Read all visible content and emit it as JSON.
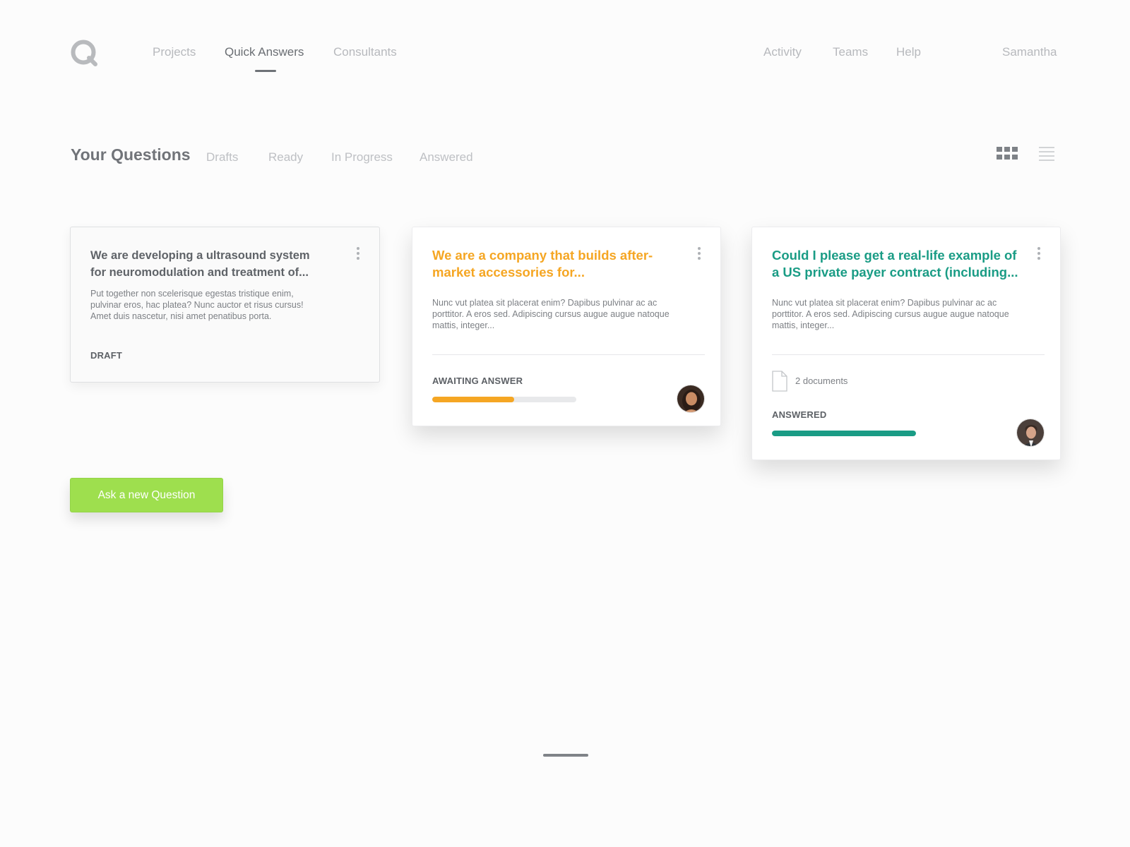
{
  "nav": {
    "logo_icon": "q-logo-icon",
    "left_links": [
      "Projects",
      "Quick Answers",
      "Consultants"
    ],
    "active_link": "Quick Answers",
    "right_links": [
      "Activity",
      "Teams",
      "Help"
    ],
    "user_name": "Samantha"
  },
  "questions": {
    "title": "Your Questions",
    "filters": [
      "Drafts",
      "Ready",
      "In Progress",
      "Answered"
    ],
    "view_icons": [
      "grid-view-icon",
      "list-view-icon"
    ]
  },
  "cards": [
    {
      "title": "We are developing a ultrasound system for neuromodulation and treatment of...",
      "body": "Put together non scelerisque egestas tristique enim, pulvinar eros, hac platea? Nunc auctor et risus cursus! Amet duis nascetur, nisi amet penatibus porta.",
      "status": "DRAFT"
    },
    {
      "title": "We are a company that builds after-market accessories for...",
      "body": "Nunc vut platea sit placerat enim? Dapibus pulvinar ac ac porttitor. A eros sed. Adipiscing cursus augue augue natoque mattis, integer...",
      "status": "AWAITING ANSWER",
      "progress": 0.57,
      "color": "#f5a623"
    },
    {
      "title": "Could I please get a real-life example of a US private payer contract (including...",
      "body": "Nunc vut platea sit placerat enim? Dapibus pulvinar ac ac porttitor. A eros sed. Adipiscing cursus augue augue natoque mattis, integer...",
      "documents": "2 documents",
      "status": "ANSWERED",
      "progress": 1.0,
      "color": "#1a9c85"
    }
  ],
  "cta": {
    "label": "Ask a new Question",
    "color": "#9edf4e"
  },
  "colors": {
    "accent_orange": "#f5a623",
    "accent_teal": "#1a9c85",
    "accent_green": "#9edf4e"
  }
}
